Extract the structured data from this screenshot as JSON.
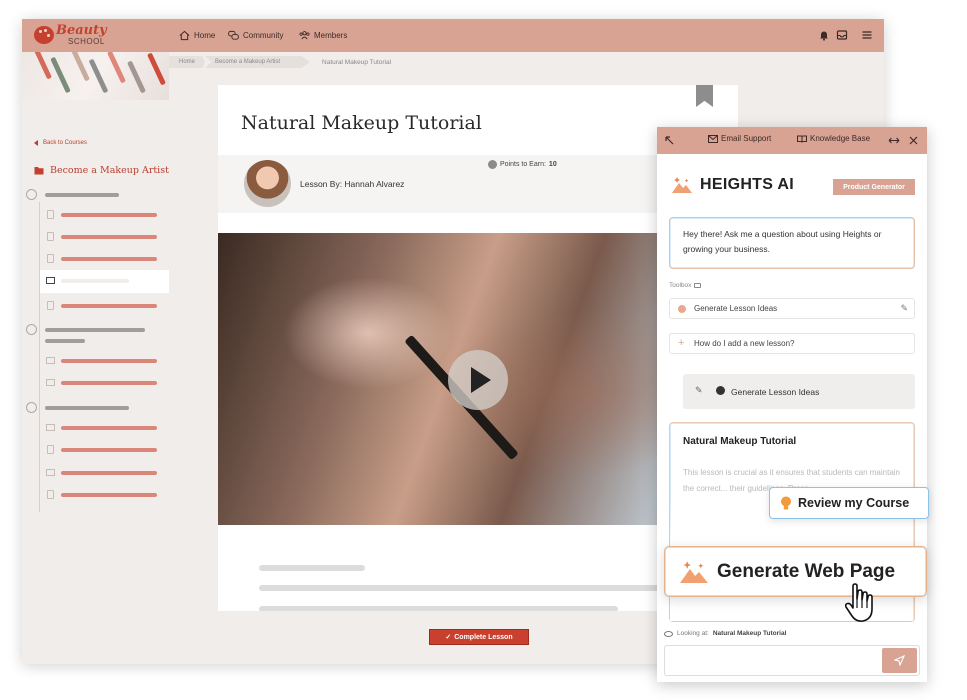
{
  "app": {
    "logo": {
      "line1": "Beauty",
      "line2": "SCHOOL"
    },
    "nav": [
      {
        "label": "Home",
        "icon": "home-icon"
      },
      {
        "label": "Community",
        "icon": "chat-bubbles-icon"
      },
      {
        "label": "Members",
        "icon": "members-icon"
      }
    ],
    "top_icons": [
      "bell-icon",
      "inbox-icon",
      "menu-icon"
    ]
  },
  "breadcrumb": [
    "Home",
    "Become a Makeup Artist",
    "Natural Makeup Tutorial"
  ],
  "sidebar": {
    "back_label": "Back to Courses",
    "course_title": "Become a Makeup Artist"
  },
  "lesson": {
    "title": "Natural Makeup Tutorial",
    "author": "Lesson By: Hannah Alvarez",
    "points_label": "Points to Earn:",
    "points_value": "10",
    "complete_label": "Complete Lesson"
  },
  "assistant": {
    "top_links": {
      "email": "Email Support",
      "kb": "Knowledge Base"
    },
    "brand": "HEIGHTS AI",
    "badge": "Product Generator",
    "greeting": "Hey there! Ask me a question about using Heights or growing your business.",
    "toolbox_label": "Toolbox",
    "tool_generate": "Generate Lesson Ideas",
    "tool_question": "How do I add a new lesson?",
    "generate_ideas_button": "Generate Lesson Ideas",
    "card_title": "Natural Makeup Tutorial",
    "card_body": "This lesson is crucial as it ensures that students can maintain the correct... their guidelines. Proce...",
    "looking_label": "Looking at:",
    "looking_value": "Natural Makeup Tutorial"
  },
  "floating": {
    "review": "Review my Course",
    "generate_web": "Generate Web Page"
  },
  "colors": {
    "accent": "#d9a394",
    "brand_red": "#c9402e",
    "sidebar_bg": "#f1edeb"
  }
}
